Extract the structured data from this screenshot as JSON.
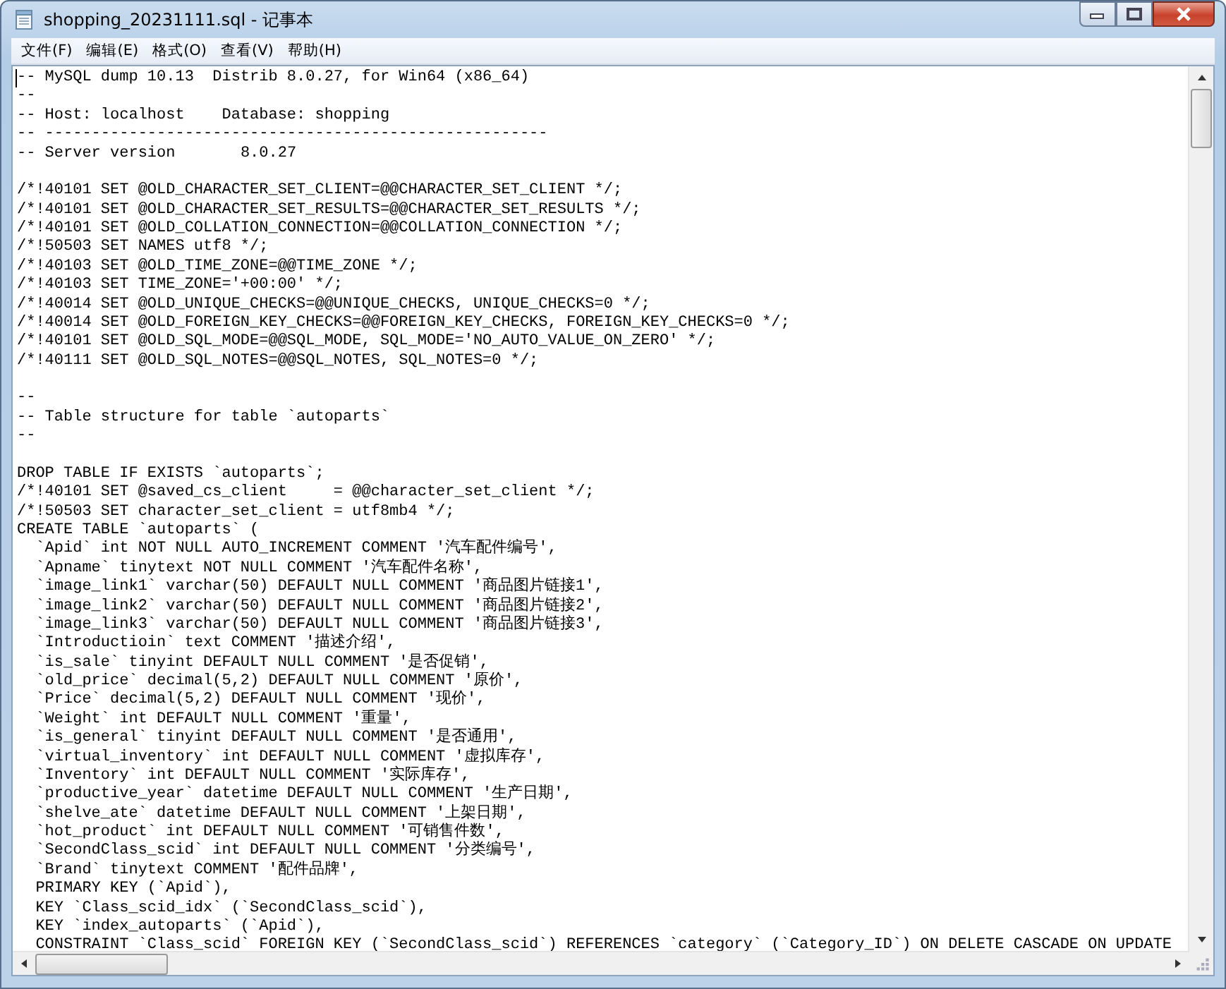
{
  "window": {
    "title": "shopping_20231111.sql - 记事本",
    "menu": [
      "文件(F)",
      "编辑(E)",
      "格式(O)",
      "查看(V)",
      "帮助(H)"
    ],
    "editor": {
      "caret": true,
      "blocks": [
        [
          "-- MySQL dump 10.13  Distrib 8.0.27, for Win64 (x86_64)",
          "--",
          "-- Host: localhost    Database: shopping",
          "-- ------------------------------------------------------",
          "-- Server version\t8.0.27"
        ],
        [
          "/*!40101 SET @OLD_CHARACTER_SET_CLIENT=@@CHARACTER_SET_CLIENT */;",
          "/*!40101 SET @OLD_CHARACTER_SET_RESULTS=@@CHARACTER_SET_RESULTS */;",
          "/*!40101 SET @OLD_COLLATION_CONNECTION=@@COLLATION_CONNECTION */;",
          "/*!50503 SET NAMES utf8 */;",
          "/*!40103 SET @OLD_TIME_ZONE=@@TIME_ZONE */;",
          "/*!40103 SET TIME_ZONE='+00:00' */;",
          "/*!40014 SET @OLD_UNIQUE_CHECKS=@@UNIQUE_CHECKS, UNIQUE_CHECKS=0 */;",
          "/*!40014 SET @OLD_FOREIGN_KEY_CHECKS=@@FOREIGN_KEY_CHECKS, FOREIGN_KEY_CHECKS=0 */;",
          "/*!40101 SET @OLD_SQL_MODE=@@SQL_MODE, SQL_MODE='NO_AUTO_VALUE_ON_ZERO' */;",
          "/*!40111 SET @OLD_SQL_NOTES=@@SQL_NOTES, SQL_NOTES=0 */;"
        ],
        [
          "--",
          "-- Table structure for table `autoparts`",
          "--"
        ],
        [
          "DROP TABLE IF EXISTS `autoparts`;",
          "/*!40101 SET @saved_cs_client     = @@character_set_client */;",
          "/*!50503 SET character_set_client = utf8mb4 */;",
          "CREATE TABLE `autoparts` (",
          "  `Apid` int NOT NULL AUTO_INCREMENT COMMENT '汽车配件编号',",
          "  `Apname` tinytext NOT NULL COMMENT '汽车配件名称',",
          "  `image_link1` varchar(50) DEFAULT NULL COMMENT '商品图片链接1',",
          "  `image_link2` varchar(50) DEFAULT NULL COMMENT '商品图片链接2',",
          "  `image_link3` varchar(50) DEFAULT NULL COMMENT '商品图片链接3',",
          "  `Introductioin` text COMMENT '描述介绍',",
          "  `is_sale` tinyint DEFAULT NULL COMMENT '是否促销',",
          "  `old_price` decimal(5,2) DEFAULT NULL COMMENT '原价',",
          "  `Price` decimal(5,2) DEFAULT NULL COMMENT '现价',",
          "  `Weight` int DEFAULT NULL COMMENT '重量',",
          "  `is_general` tinyint DEFAULT NULL COMMENT '是否通用',",
          "  `virtual_inventory` int DEFAULT NULL COMMENT '虚拟库存',",
          "  `Inventory` int DEFAULT NULL COMMENT '实际库存',",
          "  `productive_year` datetime DEFAULT NULL COMMENT '生产日期',",
          "  `shelve_ate` datetime DEFAULT NULL COMMENT '上架日期',",
          "  `hot_product` int DEFAULT NULL COMMENT '可销售件数',",
          "  `SecondClass_scid` int DEFAULT NULL COMMENT '分类编号',",
          "  `Brand` tinytext COMMENT '配件品牌',",
          "  PRIMARY KEY (`Apid`),",
          "  KEY `Class_scid_idx` (`SecondClass_scid`),",
          "  KEY `index_autoparts` (`Apid`),",
          "  CONSTRAINT `Class_scid` FOREIGN KEY (`SecondClass_scid`) REFERENCES `category` (`Category_ID`) ON DELETE CASCADE ON UPDATE"
        ]
      ]
    }
  }
}
